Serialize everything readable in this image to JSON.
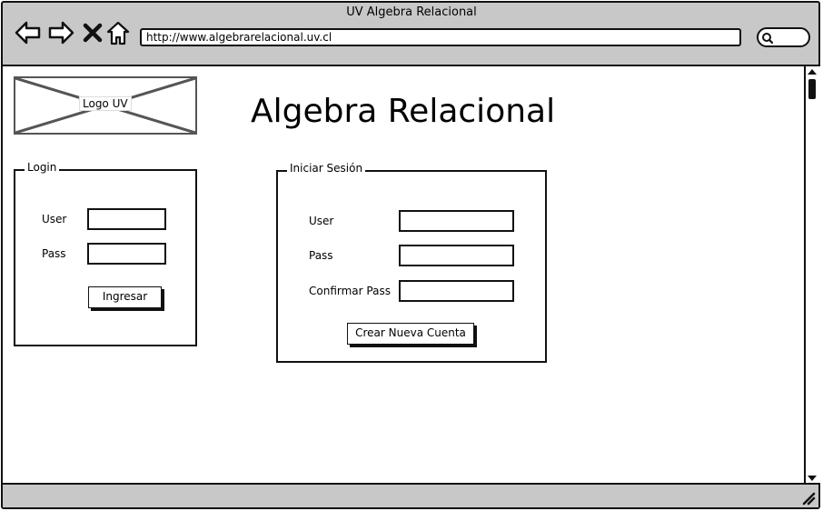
{
  "window": {
    "title": "UV Algebra Relacional"
  },
  "browser": {
    "url": "http://www.algebrarelacional.uv.cl",
    "icons": [
      "back-arrow-icon",
      "forward-arrow-icon",
      "close-icon",
      "home-icon",
      "search-icon"
    ]
  },
  "page": {
    "logo_label": "Logo UV",
    "heading": "Algebra Relacional"
  },
  "login": {
    "legend": "Login",
    "user_label": "User",
    "pass_label": "Pass",
    "submit_label": "Ingresar"
  },
  "signup": {
    "legend": "Iniciar Sesión",
    "user_label": "User",
    "pass_label": "Pass",
    "confirm_label": "Confirmar Pass",
    "submit_label": "Crear Nueva Cuenta"
  }
}
